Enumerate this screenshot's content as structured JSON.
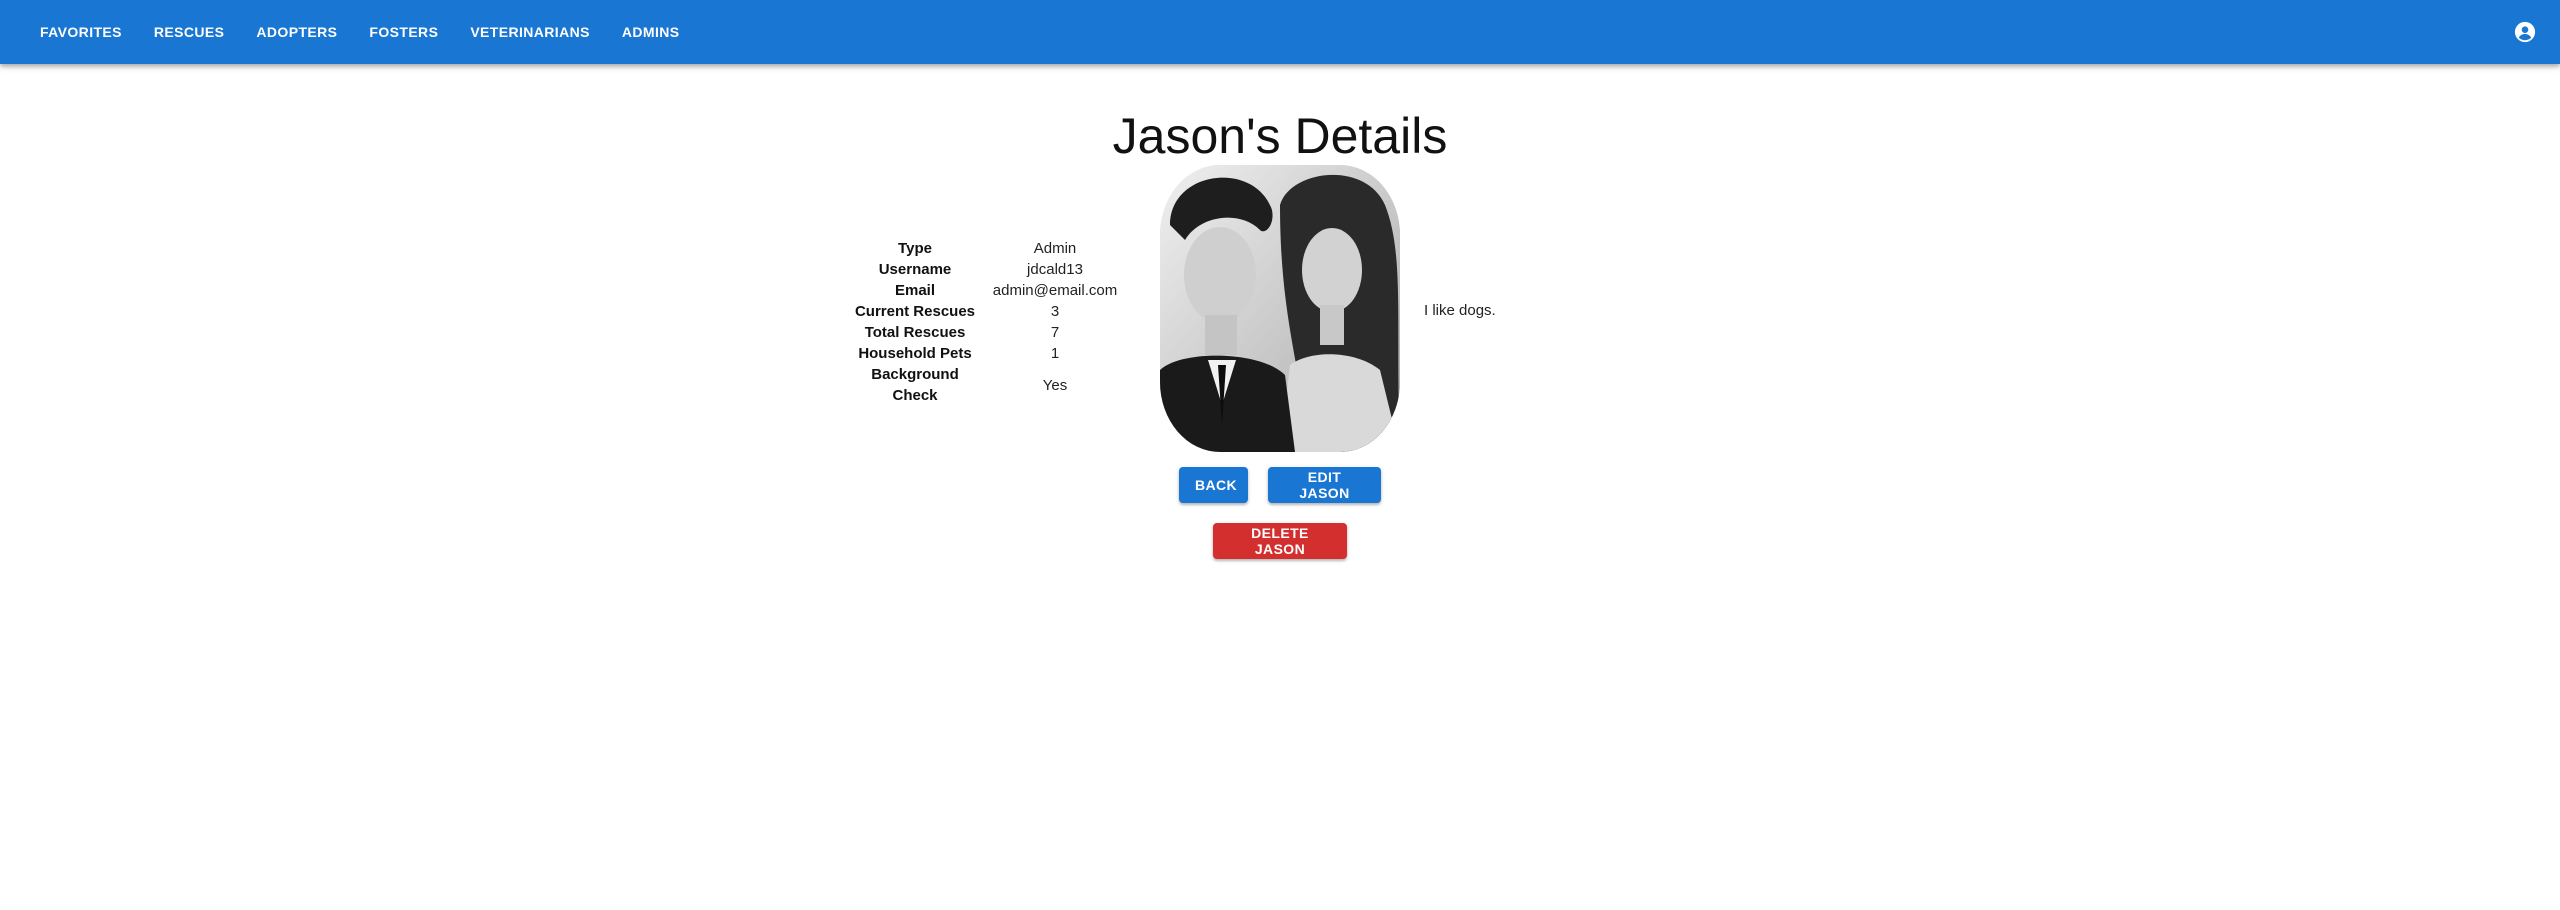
{
  "nav": {
    "items": [
      {
        "label": "FAVORITES"
      },
      {
        "label": "RESCUES"
      },
      {
        "label": "ADOPTERS"
      },
      {
        "label": "FOSTERS"
      },
      {
        "label": "VETERINARIANS"
      },
      {
        "label": "ADMINS"
      }
    ],
    "account_icon": "account-circle-icon"
  },
  "page": {
    "title": "Jason's Details"
  },
  "details": {
    "rows": [
      {
        "label": "Type",
        "value": "Admin"
      },
      {
        "label": "Username",
        "value": "jdcald13"
      },
      {
        "label": "Email",
        "value": "admin@email.com"
      },
      {
        "label": "Current Rescues",
        "value": "3"
      },
      {
        "label": "Total Rescues",
        "value": "7"
      },
      {
        "label": "Household Pets",
        "value": "1"
      },
      {
        "label": "Background Check",
        "value": "Yes"
      }
    ]
  },
  "bio": "I like dogs.",
  "actions": {
    "back_label": "BACK",
    "edit_label": "EDIT JASON",
    "delete_label": "DELETE JASON"
  },
  "colors": {
    "primary": "#1976d2",
    "danger": "#d32f2f"
  }
}
